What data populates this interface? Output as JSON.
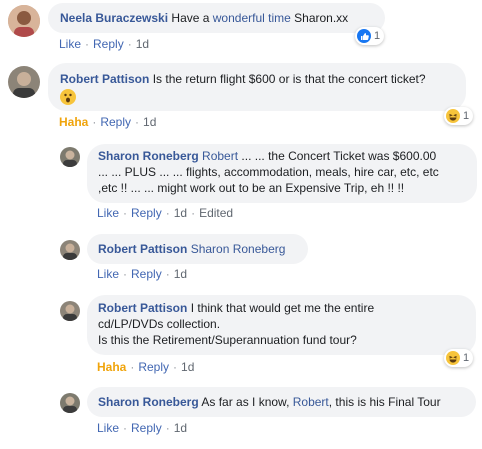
{
  "comments": [
    {
      "author": "Neela Buraczewski",
      "text_before": "Have a ",
      "highlight": "wonderful time",
      "text_after": " Sharon.xx",
      "actions": [
        "Like",
        "Reply",
        "1d"
      ],
      "reaction_count": "1"
    },
    {
      "author": "Robert Pattison",
      "text": "Is the return flight $600 or is that the concert ticket?",
      "actions": [
        "Haha",
        "Reply",
        "1d"
      ],
      "reaction_count": "1"
    }
  ],
  "replies": [
    {
      "author": "Sharon Roneberg",
      "mention": "Robert",
      "lines": [
        "... ... the Concert Ticket was $600.00",
        "... ... PLUS ... ... flights, accommodation, meals, hire car, etc, etc",
        ",etc !! ... ... might work out to be an Expensive Trip, eh !! !!"
      ],
      "actions": [
        "Like",
        "Reply",
        "1d",
        "Edited"
      ]
    },
    {
      "author": "Robert Pattison",
      "mention": "Sharon Roneberg",
      "actions": [
        "Like",
        "Reply",
        "1d"
      ]
    },
    {
      "author": "Robert Pattison",
      "lines": [
        "I think that would get me the entire",
        "cd/LP/DVDs collection.",
        "Is this the Retirement/Superannuation fund tour?"
      ],
      "actions": [
        "Haha",
        "Reply",
        "1d"
      ],
      "reaction_count": "1"
    },
    {
      "author": "Sharon Roneberg",
      "text_before": "As far as I know, ",
      "mention": "Robert",
      "text_after": ", this is his Final Tour",
      "actions": [
        "Like",
        "Reply",
        "1d"
      ]
    }
  ],
  "icons": {
    "like": "thumbs-up-icon",
    "haha": "laughing-face-icon",
    "emoji": "face-with-open-mouth-icon"
  },
  "colors": {
    "author": "#385898",
    "link": "#4267b2",
    "haha": "#f0a40c",
    "bubble": "#f2f3f5"
  }
}
